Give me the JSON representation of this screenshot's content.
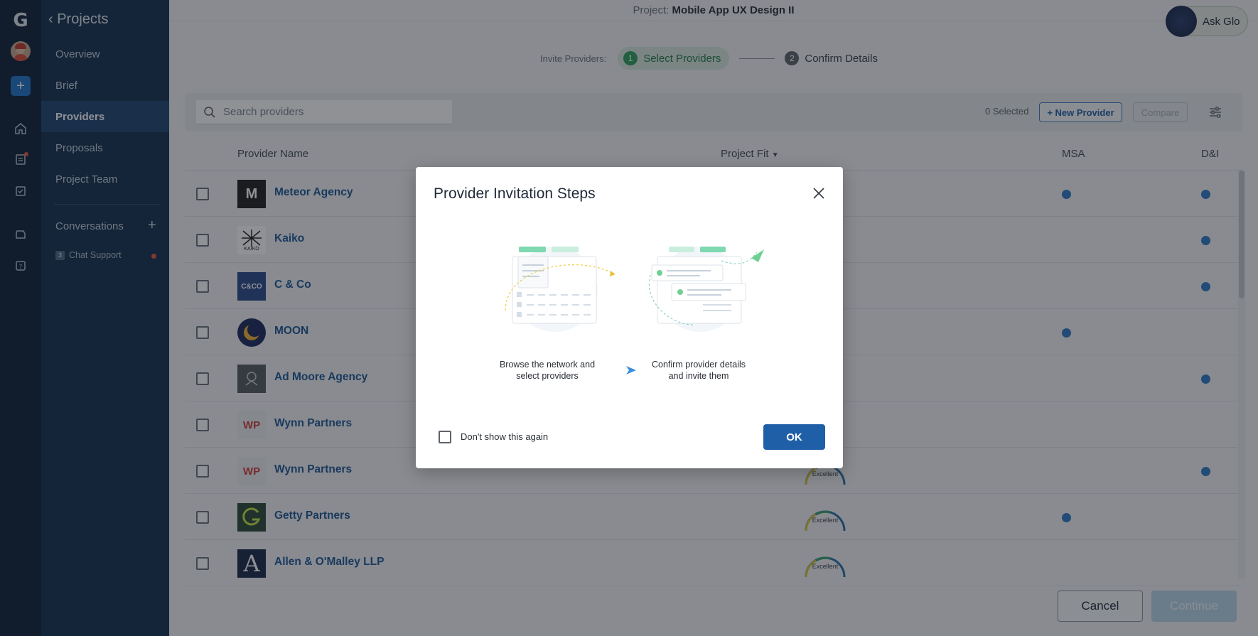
{
  "rail": {
    "logo": "G",
    "add_label": "+"
  },
  "sidebar": {
    "back_label": "Projects",
    "items": [
      {
        "label": "Overview"
      },
      {
        "label": "Brief"
      },
      {
        "label": "Providers",
        "active": true
      },
      {
        "label": "Proposals"
      },
      {
        "label": "Project Team"
      }
    ],
    "conversations_label": "Conversations",
    "chat_badge": "3",
    "chat_label": "Chat Support"
  },
  "header": {
    "project_prefix": "Project: ",
    "project_name": "Mobile App UX Design II",
    "ask_glo": "Ask Glo"
  },
  "steps": {
    "prefix": "Invite Providers:",
    "step1_num": "1",
    "step1_label": "Select Providers",
    "step2_num": "2",
    "step2_label": "Confirm Details"
  },
  "toolbar": {
    "search_placeholder": "Search providers",
    "selected_count": "0 Selected",
    "new_provider": "+ New Provider",
    "compare": "Compare"
  },
  "table": {
    "headers": {
      "name": "Provider Name",
      "fit": "Project Fit",
      "msa": "MSA",
      "dni": "D&I"
    },
    "rows": [
      {
        "name": "Meteor Agency",
        "logo": "M",
        "fit": "",
        "msa": true,
        "dni": true
      },
      {
        "name": "Kaiko",
        "logo": "KAIKO",
        "fit": "",
        "msa": false,
        "dni": true
      },
      {
        "name": "C & Co",
        "logo": "C&CO",
        "fit": "",
        "msa": false,
        "dni": true
      },
      {
        "name": "MOON",
        "logo": "",
        "fit": "",
        "msa": true,
        "dni": false
      },
      {
        "name": "Ad Moore Agency",
        "logo": "",
        "fit": "",
        "msa": false,
        "dni": true
      },
      {
        "name": "Wynn Partners",
        "logo": "WP",
        "fit": "",
        "msa": false,
        "dni": false
      },
      {
        "name": "Wynn Partners",
        "logo": "WP",
        "fit": "Excellent",
        "msa": false,
        "dni": true
      },
      {
        "name": "Getty Partners",
        "logo": "",
        "fit": "Excellent",
        "msa": true,
        "dni": false
      },
      {
        "name": "Allen & O'Malley LLP",
        "logo": "A",
        "fit": "Excellent",
        "msa": false,
        "dni": false
      }
    ]
  },
  "footer": {
    "cancel": "Cancel",
    "continue": "Continue"
  },
  "dialog": {
    "title": "Provider Invitation Steps",
    "step1_caption_line1": "Browse the network and",
    "step1_caption_line2": "select providers",
    "step2_caption_line1": "Confirm provider details",
    "step2_caption_line2": "and invite them",
    "checkbox_label": "Don't show this again",
    "ok": "OK"
  },
  "colors": {
    "rail": "#0f2238",
    "sidebar": "#15304f",
    "accent": "#1f5fa8",
    "step_active": "#2f9e5c",
    "indicator": "#2f7ac6"
  }
}
